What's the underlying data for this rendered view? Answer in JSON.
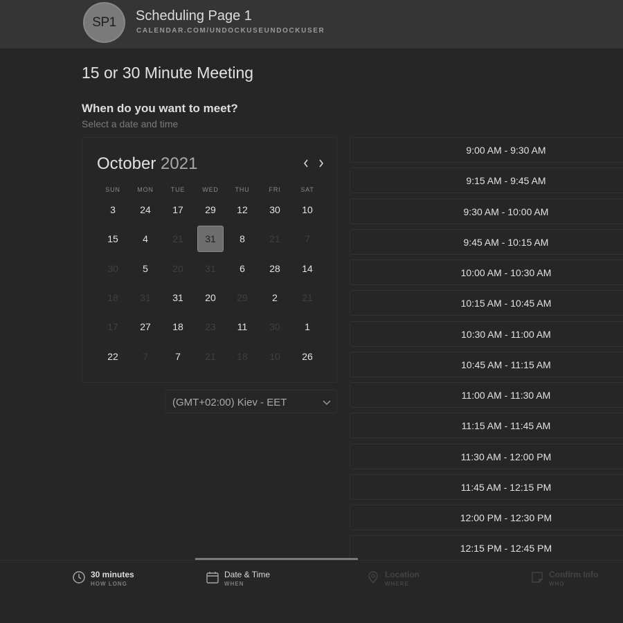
{
  "header": {
    "avatar_initials": "SP1",
    "page_name": "Scheduling Page 1",
    "page_url": "CALENDAR.COM/UNDOCKUSEUNDOCKUSER"
  },
  "meeting": {
    "title": "15 or 30 Minute Meeting",
    "question": "When do you want to meet?",
    "hint": "Select a date and time"
  },
  "calendar": {
    "month": "October",
    "year": "2021",
    "weekdays": [
      "SUN",
      "MON",
      "TUE",
      "WED",
      "THU",
      "FRI",
      "SAT"
    ],
    "weeks": [
      [
        {
          "d": "3"
        },
        {
          "d": "24"
        },
        {
          "d": "17"
        },
        {
          "d": "29"
        },
        {
          "d": "12"
        },
        {
          "d": "30"
        },
        {
          "d": "10"
        }
      ],
      [
        {
          "d": "15"
        },
        {
          "d": "4"
        },
        {
          "d": "21",
          "muted": true
        },
        {
          "d": "31",
          "selected": true
        },
        {
          "d": "8"
        },
        {
          "d": "21",
          "muted": true
        },
        {
          "d": "7",
          "muted": true
        }
      ],
      [
        {
          "d": "30",
          "muted": true
        },
        {
          "d": "5"
        },
        {
          "d": "20",
          "muted": true
        },
        {
          "d": "31",
          "muted": true
        },
        {
          "d": "6"
        },
        {
          "d": "28"
        },
        {
          "d": "14"
        }
      ],
      [
        {
          "d": "18",
          "muted": true
        },
        {
          "d": "31",
          "muted": true
        },
        {
          "d": "31"
        },
        {
          "d": "20"
        },
        {
          "d": "29",
          "muted": true
        },
        {
          "d": "2"
        },
        {
          "d": "21",
          "muted": true
        }
      ],
      [
        {
          "d": "17",
          "muted": true
        },
        {
          "d": "27"
        },
        {
          "d": "18"
        },
        {
          "d": "23",
          "muted": true
        },
        {
          "d": "11"
        },
        {
          "d": "30",
          "muted": true
        },
        {
          "d": "1"
        }
      ],
      [
        {
          "d": "22"
        },
        {
          "d": "7",
          "muted": true
        },
        {
          "d": "7"
        },
        {
          "d": "21",
          "muted": true
        },
        {
          "d": "18",
          "muted": true
        },
        {
          "d": "10",
          "muted": true
        },
        {
          "d": "26"
        }
      ]
    ]
  },
  "timezone": {
    "label": "(GMT+02:00) Kiev - EET"
  },
  "time_slots": [
    "9:00 AM - 9:30 AM",
    "9:15 AM - 9:45 AM",
    "9:30 AM - 10:00 AM",
    "9:45 AM - 10:15 AM",
    "10:00 AM - 10:30 AM",
    "10:15 AM - 10:45 AM",
    "10:30 AM - 11:00 AM",
    "10:45 AM - 11:15 AM",
    "11:00 AM - 11:30 AM",
    "11:15 AM - 11:45 AM",
    "11:30 AM - 12:00 PM",
    "11:45 AM - 12:15 PM",
    "12:00 PM - 12:30 PM",
    "12:15 PM - 12:45 PM"
  ],
  "steps": [
    {
      "title": "30 minutes",
      "sub": "HOW LONG",
      "icon": "clock-icon",
      "state": "done"
    },
    {
      "title": "Date & Time",
      "sub": "WHEN",
      "icon": "calendar-icon",
      "state": "active"
    },
    {
      "title": "Location",
      "sub": "WHERE",
      "icon": "location-pin-icon",
      "state": "dim"
    },
    {
      "title": "Confirm Info",
      "sub": "WHO",
      "icon": "note-icon",
      "state": "dim"
    }
  ],
  "colors": {
    "background": "#262626",
    "header": "#353535",
    "selected_day": "#6e6e6e",
    "border": "#303030"
  }
}
